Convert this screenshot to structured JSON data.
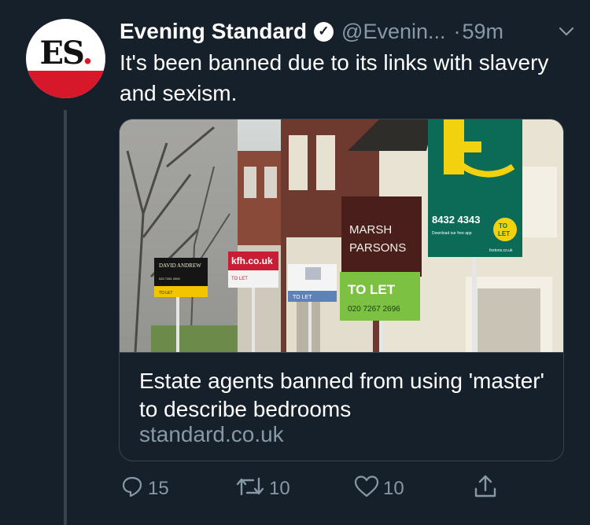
{
  "account": {
    "display_name": "Evening Standard",
    "handle": "@Evenin...",
    "separator": "·",
    "time": "59m",
    "avatar_text": "ES",
    "avatar_dot": "."
  },
  "tweet": {
    "text": "It's been banned due to its links with slavery and sexism."
  },
  "card": {
    "title": "Estate agents banned from using 'master' to describe bedrooms",
    "domain": "standard.co.uk",
    "image": {
      "sign_david": "DAVID ANDREW",
      "sign_david_phone": "020 7281 2000",
      "sign_david_letting": "TO LET",
      "sign_kfh": "kfh.co.uk",
      "sign_kfh_sub": "TO LET",
      "sign_small": "TO LET",
      "sign_marsh_line1": "MARSH",
      "sign_marsh_line2": "PARSONS",
      "sign_to_let": "TO LET",
      "sign_phone": "020 7267 2696",
      "sign_foxtons_phone": "8432 4343",
      "sign_foxtons_app": "Download our free app",
      "sign_foxtons_to": "TO",
      "sign_foxtons_let": "LET",
      "sign_foxtons_site": "foxtons.co.uk"
    }
  },
  "actions": {
    "replies": "15",
    "retweets": "10",
    "likes": "10"
  },
  "colors": {
    "background": "#15202b",
    "secondary_text": "#8899a6",
    "border": "#38444d",
    "brand_red": "#d7182a"
  },
  "icons": [
    "verified-badge-icon",
    "chevron-down-icon",
    "reply-icon",
    "retweet-icon",
    "like-icon",
    "share-icon"
  ]
}
